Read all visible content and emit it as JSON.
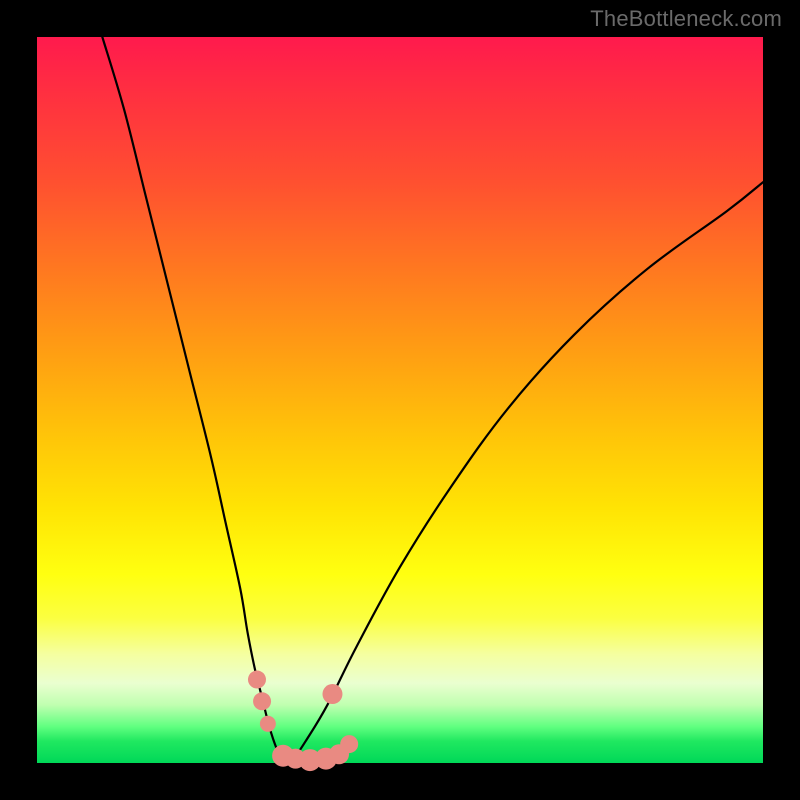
{
  "watermark": "TheBottleneck.com",
  "chart_data": {
    "type": "line",
    "title": "",
    "xlabel": "",
    "ylabel": "",
    "xlim": [
      0,
      100
    ],
    "ylim": [
      0,
      100
    ],
    "grid": false,
    "legend": false,
    "series": [
      {
        "name": "left-curve",
        "x": [
          9,
          12,
          15,
          18,
          21,
          24,
          26,
          28,
          29,
          30,
          31,
          32,
          33,
          34
        ],
        "y": [
          100,
          90,
          78,
          66,
          54,
          42,
          33,
          24,
          18,
          13,
          9,
          5,
          2,
          0
        ]
      },
      {
        "name": "right-curve",
        "x": [
          35,
          37,
          40,
          44,
          50,
          57,
          65,
          74,
          84,
          95,
          100
        ],
        "y": [
          0,
          3,
          8,
          16,
          27,
          38,
          49,
          59,
          68,
          76,
          80
        ]
      },
      {
        "name": "floor-segment",
        "x": [
          33,
          42
        ],
        "y": [
          0,
          0
        ]
      }
    ],
    "markers": {
      "name": "highlight-dots",
      "color": "#e98a82",
      "points": [
        {
          "x": 30.3,
          "y": 11.5,
          "r": 9
        },
        {
          "x": 31.0,
          "y": 8.5,
          "r": 9
        },
        {
          "x": 31.8,
          "y": 5.4,
          "r": 8
        },
        {
          "x": 33.9,
          "y": 1.0,
          "r": 11
        },
        {
          "x": 35.6,
          "y": 0.6,
          "r": 10
        },
        {
          "x": 37.6,
          "y": 0.4,
          "r": 11
        },
        {
          "x": 39.8,
          "y": 0.6,
          "r": 11
        },
        {
          "x": 41.6,
          "y": 1.2,
          "r": 10
        },
        {
          "x": 43.0,
          "y": 2.6,
          "r": 9
        },
        {
          "x": 40.7,
          "y": 9.5,
          "r": 10
        }
      ]
    },
    "background_gradient": {
      "top": "#ff1a4d",
      "mid": "#ffff10",
      "bottom": "#00d858"
    }
  }
}
